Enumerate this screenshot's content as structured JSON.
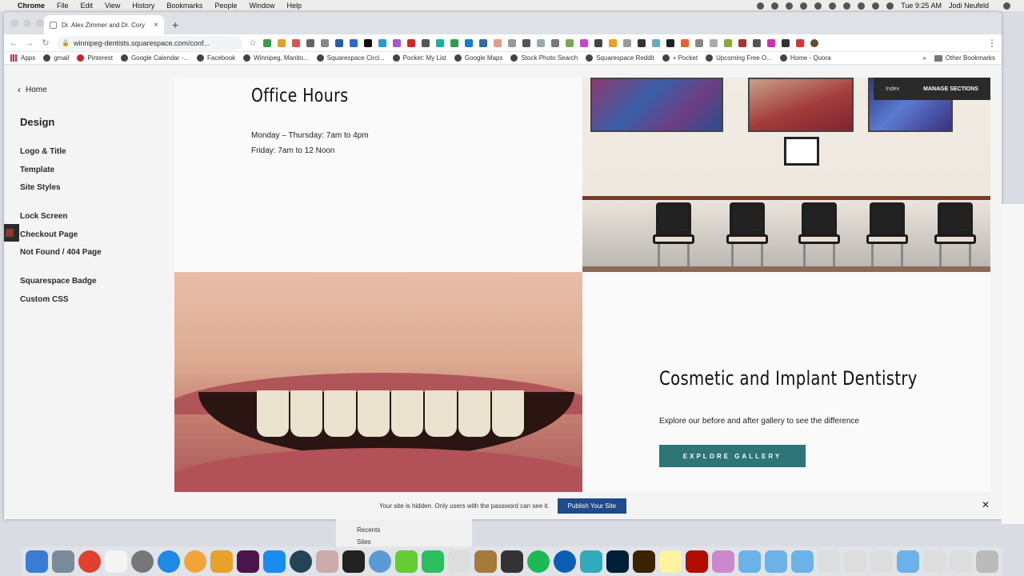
{
  "menubar": {
    "app": "Chrome",
    "items": [
      "File",
      "Edit",
      "View",
      "History",
      "Bookmarks",
      "People",
      "Window",
      "Help"
    ],
    "clock": "Tue 9:25 AM",
    "user": "Jodi Neufeld"
  },
  "browser": {
    "tab_title": "Dr. Alex Zimmer and Dr. Cory",
    "url": "winnipeg-dentists.squarespace.com/conf...",
    "bookmarks": [
      "Apps",
      "gmail",
      "Pinterest",
      "Google Calendar -...",
      "Facebook",
      "Winnipeg, Manito...",
      "Squarespace Circl...",
      "Pocket: My List",
      "Google Maps",
      "Stock Photo Search",
      "Squarespace Reddit",
      "+ Pocket",
      "Upcoming Free O...",
      "Home - Quora"
    ],
    "other_bookmarks": "Other Bookmarks",
    "overflow": "»"
  },
  "sidebar": {
    "home": "Home",
    "title": "Design",
    "items": [
      "Logo & Title",
      "Template",
      "Site Styles",
      "Lock Screen",
      "Checkout Page",
      "Not Found / 404 Page",
      "Squarespace Badge",
      "Custom CSS"
    ]
  },
  "preview": {
    "manage": {
      "index": "Index",
      "manage_sections": "MANAGE SECTIONS"
    },
    "office_hours": {
      "title": "Office Hours",
      "line1": "Monday – Thursday: 7am to 4pm",
      "line2": "Friday: 7am to 12 Noon"
    },
    "cosmetic": {
      "title": "Cosmetic and Implant Dentistry",
      "body": "Explore our before and after gallery to see the difference",
      "button": "EXPLORE GALLERY"
    }
  },
  "notice": {
    "text": "Your site is hidden. Only users with the password can see it.",
    "button": "Publish Your Site"
  },
  "background": {
    "finder_recents": "Recents",
    "finder_sites": "Sites"
  }
}
